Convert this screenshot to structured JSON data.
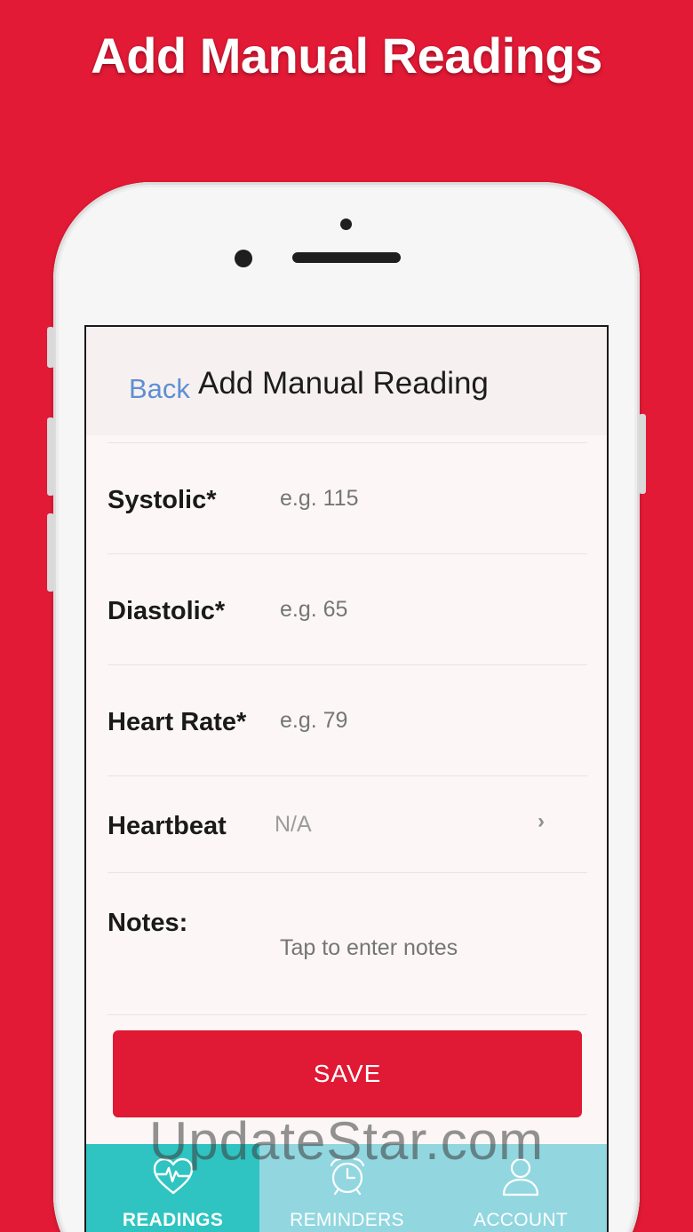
{
  "promo": {
    "title": "Add Manual Readings"
  },
  "nav": {
    "back_label": "Back",
    "title": "Add Manual Reading"
  },
  "form": {
    "systolic": {
      "label": "Systolic*",
      "placeholder": "e.g. 115"
    },
    "diastolic": {
      "label": "Diastolic*",
      "placeholder": "e.g. 65"
    },
    "heart_rate": {
      "label": "Heart Rate*",
      "placeholder": "e.g. 79"
    },
    "heartbeat": {
      "label": "Heartbeat",
      "value": "N/A",
      "chevron": "›"
    },
    "notes": {
      "label": "Notes:",
      "placeholder": "Tap to enter notes"
    }
  },
  "save_button": {
    "label": "SAVE"
  },
  "tabs": [
    {
      "label": "READINGS",
      "icon": "heart-pulse-icon",
      "active": true
    },
    {
      "label": "REMINDERS",
      "icon": "alarm-clock-icon",
      "active": false
    },
    {
      "label": "ACCOUNT",
      "icon": "user-icon",
      "active": false
    }
  ],
  "colors": {
    "background": "#e31a36",
    "accent": "#e01934",
    "link": "#5f8fd3",
    "tab_active": "#2fc4c1",
    "tab_inactive": "#92d7e0"
  },
  "watermark": "UpdateStar.com"
}
